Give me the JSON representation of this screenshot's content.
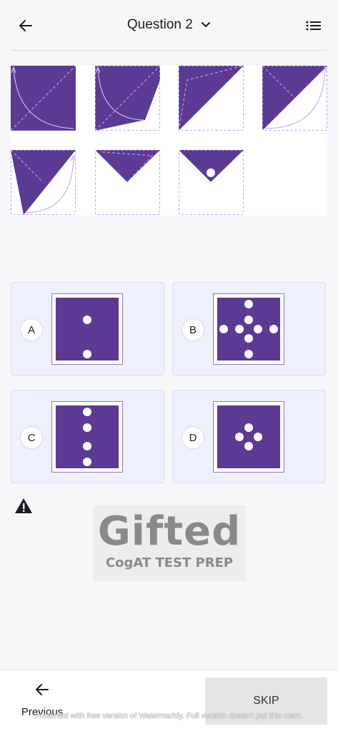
{
  "header": {
    "title": "Question 2",
    "back_icon": "arrow-left-icon",
    "dropdown_icon": "chevron-down-icon",
    "list_icon": "list-icon"
  },
  "colors": {
    "purple": "#5b3a94",
    "fold_line": "#b79be6",
    "option_bg": "#eef0fd"
  },
  "options": [
    {
      "letter": "A"
    },
    {
      "letter": "B"
    },
    {
      "letter": "C"
    },
    {
      "letter": "D"
    }
  ],
  "logo": {
    "title": "Gifted",
    "subtitle": "CogAT TEST PREP"
  },
  "footer": {
    "previous_label": "Previous",
    "skip_label": "SKIP",
    "watermark": "Protected with free version of Watermarkly. Full version doesn't put this mark."
  }
}
